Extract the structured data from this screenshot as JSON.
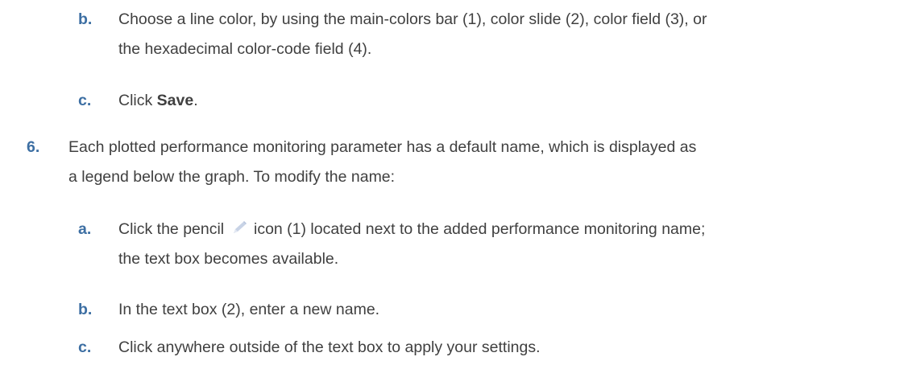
{
  "steps": {
    "b1": {
      "marker": "b.",
      "line1": "Choose a line color, by using the main-colors bar (1), color slide (2), color field (3), or",
      "line2": "the hexadecimal color-code field (4)."
    },
    "c1": {
      "marker": "c.",
      "prefix": "Click ",
      "bold": "Save",
      "suffix": "."
    },
    "s6": {
      "marker": "6.",
      "line1": "Each plotted performance monitoring parameter has a default name, which is displayed as",
      "line2": "a legend below the graph. To modify the name:"
    },
    "a2": {
      "marker": "a.",
      "line1_prefix": "Click the pencil",
      "line1_suffix": "icon (1) located next to the added performance monitoring name;",
      "line2": "the text box becomes available.",
      "icon": "pencil-icon"
    },
    "b2": {
      "marker": "b.",
      "line1": "In the text box (2), enter a new name."
    },
    "c2": {
      "marker": "c.",
      "line1": "Click anywhere outside of the text box to apply your settings."
    }
  },
  "colors": {
    "marker": "#3d6fa3",
    "text": "#404040",
    "icon": "#c8d3e6"
  }
}
